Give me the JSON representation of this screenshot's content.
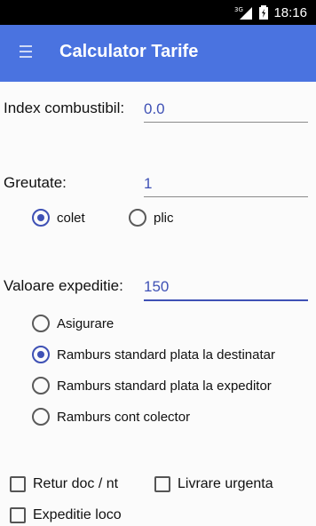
{
  "status_bar": {
    "network": "3G",
    "time": "18:16"
  },
  "app_bar": {
    "menu_icon": "hamburger-menu-icon",
    "title": "Calculator Tarife"
  },
  "form": {
    "index_label": "Index combustibil:",
    "index_value": "0.0",
    "weight_label": "Greutate:",
    "weight_value": "1",
    "package_types": [
      {
        "label": "colet",
        "selected": true
      },
      {
        "label": "plic",
        "selected": false
      }
    ],
    "value_label": "Valoare expeditie:",
    "value_value": "150",
    "options": [
      {
        "label": "Asigurare",
        "selected": false
      },
      {
        "label": "Ramburs standard plata la destinatar",
        "selected": true
      },
      {
        "label": "Ramburs standard plata la expeditor",
        "selected": false
      },
      {
        "label": "Ramburs cont colector",
        "selected": false
      }
    ],
    "checkboxes": [
      {
        "label": "Retur doc / nt",
        "checked": false
      },
      {
        "label": "Livrare urgenta",
        "checked": false
      },
      {
        "label": "Expeditie loco",
        "checked": false
      }
    ]
  },
  "colors": {
    "app_bar": "#4a73e0",
    "accent": "#3f51b5"
  }
}
